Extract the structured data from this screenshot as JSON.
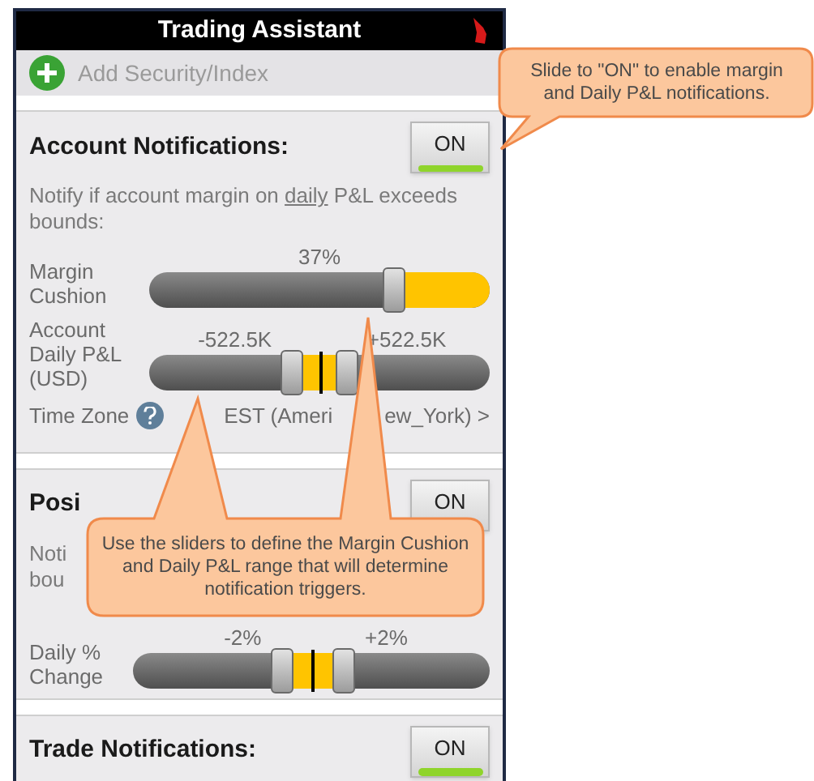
{
  "window": {
    "title": "Trading Assistant"
  },
  "add_row": {
    "label": "Add Security/Index"
  },
  "sections": [
    {
      "title": "Account Notifications:",
      "toggle": {
        "label": "ON",
        "on": true
      },
      "description": {
        "before": "Notify if account margin on ",
        "link": "daily",
        "after": " P&L exceeds bounds:"
      },
      "sliders": [
        {
          "kind": "single",
          "label": "Margin Cushion",
          "readings": [
            "37%"
          ],
          "handles": [
            {
              "level": 0.72
            }
          ]
        },
        {
          "kind": "range",
          "label": "Account Daily P&L (USD)",
          "readings": [
            "-522.5K",
            "+522.5K"
          ],
          "handles": [
            {
              "level": 0.42
            },
            {
              "level": 0.58
            }
          ]
        }
      ],
      "time_zone": {
        "label": "Time Zone",
        "value_parts": [
          "EST (Ameri",
          "ew_York) >"
        ]
      }
    },
    {
      "title": "Posi",
      "toggle": {
        "label": "ON"
      },
      "description_parts": [
        "Noti",
        "bou"
      ],
      "sliders": [
        {
          "kind": "range",
          "label": "Daily % Change",
          "readings": [
            "-2%",
            "+2%"
          ],
          "handles": [
            {
              "level": 0.42
            },
            {
              "level": 0.59
            }
          ]
        }
      ]
    },
    {
      "title": "Trade Notifications:",
      "toggle": {
        "label": "ON",
        "on": true
      }
    }
  ],
  "callouts": [
    {
      "text": "Slide to \"ON\" to enable margin and Daily P&L notifications."
    },
    {
      "text": "Use the sliders to define the Margin Cushion and Daily P&L range that will determine notification triggers."
    }
  ]
}
